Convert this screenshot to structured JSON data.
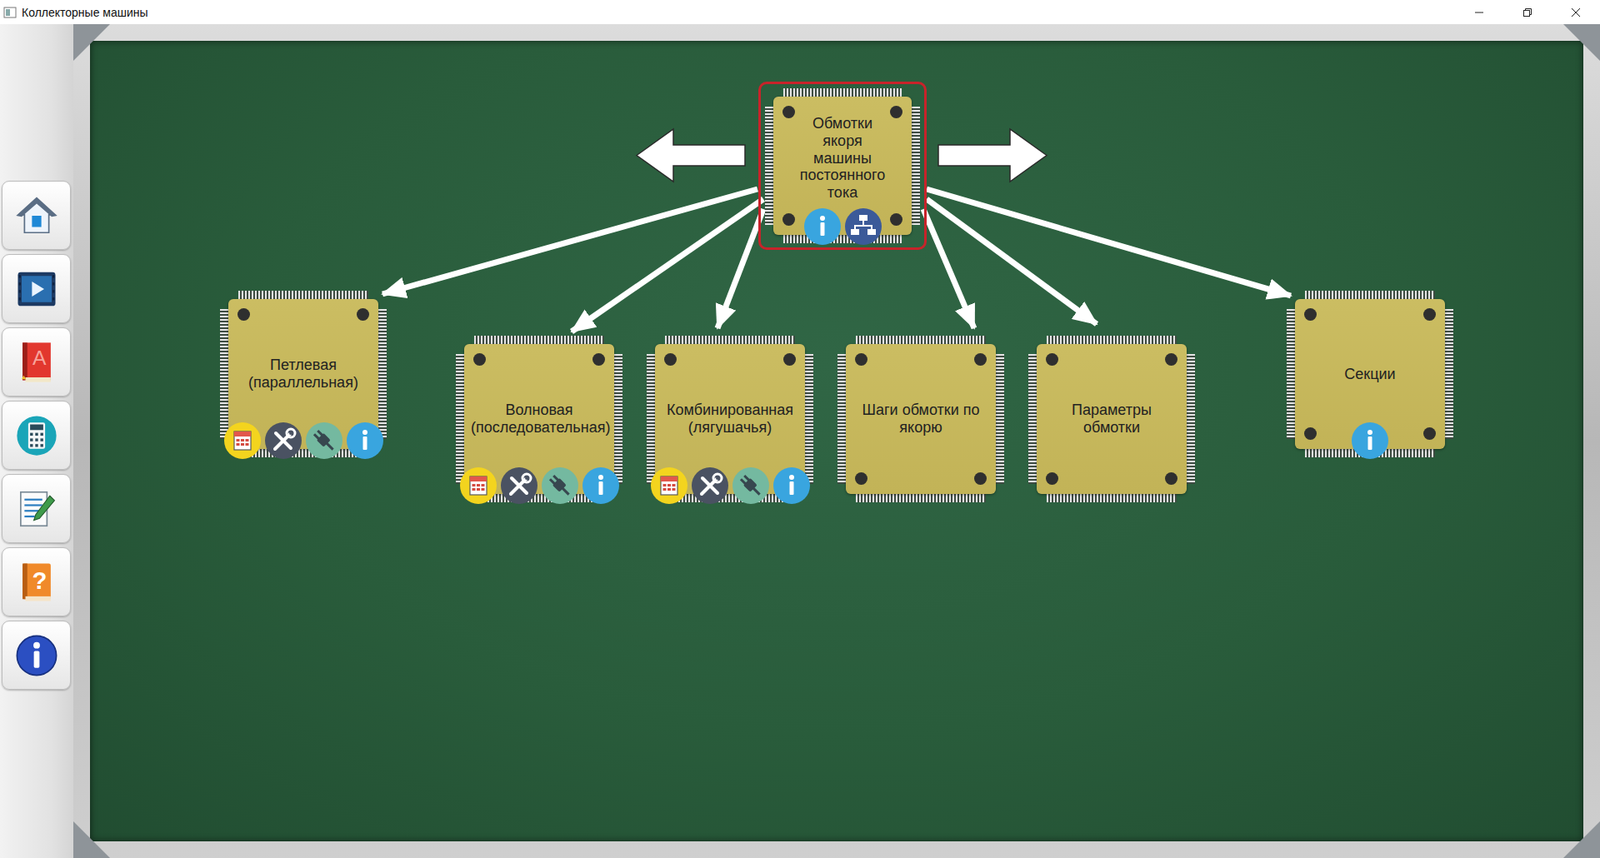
{
  "window": {
    "title": "Коллекторные машины",
    "controls": [
      {
        "kind": "minimize"
      },
      {
        "kind": "restore"
      },
      {
        "kind": "close"
      }
    ]
  },
  "sidebar": {
    "items": [
      {
        "kind": "home",
        "selected": false
      },
      {
        "kind": "video",
        "selected": false
      },
      {
        "kind": "book",
        "selected": false,
        "glyph": "A"
      },
      {
        "kind": "calculator",
        "selected": false
      },
      {
        "kind": "notes",
        "selected": false
      },
      {
        "kind": "help",
        "selected": false,
        "glyph": "?"
      },
      {
        "kind": "info",
        "selected": false
      }
    ]
  },
  "diagram": {
    "navigation": [
      {
        "kind": "prev"
      },
      {
        "kind": "next"
      }
    ],
    "root": {
      "label": "Обмотки якоря машины постоянного тока",
      "selected": true,
      "actions": [
        {
          "kind": "info"
        },
        {
          "kind": "structure"
        }
      ]
    },
    "children": [
      {
        "label": "Петлевая (параллельная)",
        "selected": false,
        "actions": [
          {
            "kind": "calc"
          },
          {
            "kind": "tools"
          },
          {
            "kind": "plug"
          },
          {
            "kind": "info"
          }
        ]
      },
      {
        "label": "Волновая (последовательная)",
        "selected": false,
        "actions": [
          {
            "kind": "calc"
          },
          {
            "kind": "tools"
          },
          {
            "kind": "plug"
          },
          {
            "kind": "info"
          }
        ]
      },
      {
        "label": "Комбинированная (лягушачья)",
        "selected": false,
        "actions": [
          {
            "kind": "calc"
          },
          {
            "kind": "tools"
          },
          {
            "kind": "plug"
          },
          {
            "kind": "info"
          }
        ]
      },
      {
        "label": "Шаги обмотки по якорю",
        "selected": false,
        "actions": []
      },
      {
        "label": "Параметры обмотки",
        "selected": false,
        "actions": []
      },
      {
        "label": "Секции",
        "selected": false,
        "actions": [
          {
            "kind": "info"
          }
        ]
      }
    ]
  }
}
